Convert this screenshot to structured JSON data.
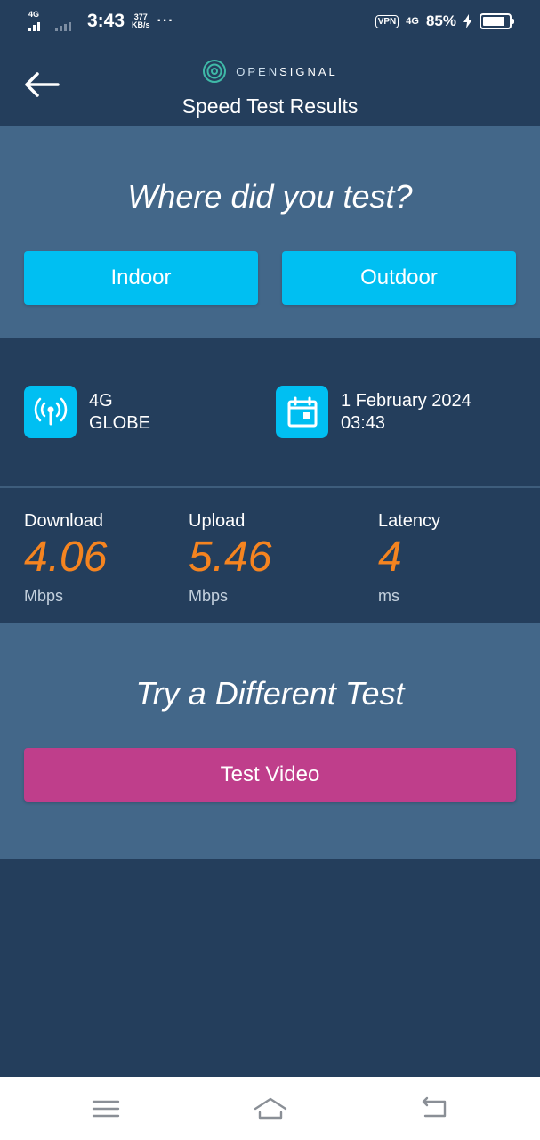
{
  "status_bar": {
    "network_type": "4G",
    "time": "3:43",
    "speed_value": "377",
    "speed_unit": "KB/s",
    "more": "···",
    "vpn": "VPN",
    "data_network": "4G",
    "battery_percent": "85%",
    "battery_level": 0.85
  },
  "header": {
    "brand_prefix": "OPEN",
    "brand_suffix": "SIGNAL",
    "title": "Speed Test Results",
    "back_icon": "arrow-left-icon"
  },
  "location_prompt": {
    "question": "Where did you test?",
    "indoor_label": "Indoor",
    "outdoor_label": "Outdoor"
  },
  "connection_info": {
    "network_icon": "antenna-icon",
    "network_type": "4G",
    "operator": "GLOBE",
    "date_icon": "calendar-icon",
    "date": "1 February 2024",
    "time": "03:43"
  },
  "results": {
    "download": {
      "label": "Download",
      "value": "4.06",
      "unit": "Mbps"
    },
    "upload": {
      "label": "Upload",
      "value": "5.46",
      "unit": "Mbps"
    },
    "latency": {
      "label": "Latency",
      "value": "4",
      "unit": "ms"
    }
  },
  "different_test": {
    "title": "Try a Different Test",
    "video_label": "Test Video"
  },
  "nav_bar": {
    "menu_icon": "menu-icon",
    "home_icon": "home-icon",
    "back_icon": "back-icon"
  },
  "colors": {
    "background": "#243e5c",
    "panel": "#436789",
    "accent_cyan": "#00bff2",
    "metric_orange": "#f58420",
    "video_button": "#bf3e8b"
  }
}
